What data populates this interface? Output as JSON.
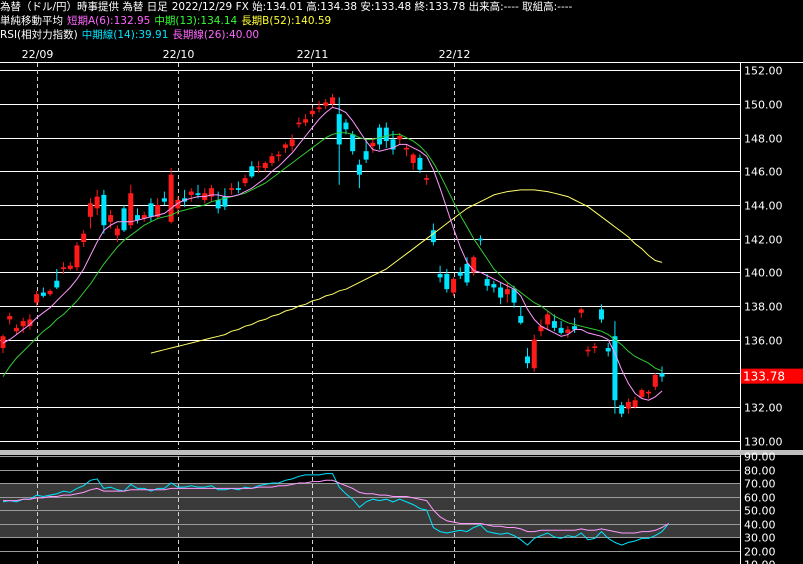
{
  "header": {
    "title": "為替（ドル/円）時事提供 為替 日足",
    "ohlc": "2022/12/29 FX 始:134.01 高:134.38 安:133.48 終:133.78 出来高:---- 取組高:----",
    "ma_label": "単純移動平均",
    "ma_short": "短期A(6):132.95",
    "ma_mid": "中期(13):134.14",
    "ma_long": "長期B(52):140.59",
    "rsi_label": "RSI(相対力指数)",
    "rsi_mid": "中期線(14):39.91",
    "rsi_long": "長期線(26):40.00"
  },
  "colors": {
    "up": "#ff1a1a",
    "down": "#00e5ff",
    "ma_short": "#ff99ff",
    "ma_mid": "#33cc33",
    "ma_long": "#ffff66",
    "rsi_mid": "#00e5ff",
    "rsi_long": "#ff99ff",
    "last_price_bg": "#ff0000",
    "header_ma_short": "#ff66ff",
    "header_ma_mid": "#33ff33",
    "header_ma_long": "#ffff33",
    "header_rsi_mid": "#00e5ff",
    "header_rsi_long": "#ff66ff"
  },
  "last_price": "133.78",
  "chart_data": [
    {
      "type": "candlestick",
      "title": "",
      "ylim": [
        129.5,
        152.5
      ],
      "y_ticks": [
        "152.00",
        "150.00",
        "148.00",
        "146.00",
        "144.00",
        "142.00",
        "140.00",
        "138.00",
        "136.00",
        "134.00",
        "132.00",
        "130.00"
      ],
      "date_labels": [
        "22/09",
        "22/10",
        "22/11",
        "22/12"
      ],
      "date_label_index": [
        5,
        26,
        46,
        67
      ],
      "candles": [
        {
          "o": 135.5,
          "h": 136.3,
          "l": 135.2,
          "c": 136.2
        },
        {
          "o": 137.2,
          "h": 137.6,
          "l": 136.9,
          "c": 137.4
        },
        {
          "o": 136.5,
          "h": 136.9,
          "l": 136.3,
          "c": 136.7
        },
        {
          "o": 136.8,
          "h": 137.3,
          "l": 136.4,
          "c": 137.1
        },
        {
          "o": 136.8,
          "h": 137.5,
          "l": 136.6,
          "c": 137.2
        },
        {
          "o": 138.2,
          "h": 138.9,
          "l": 138.0,
          "c": 138.7
        },
        {
          "o": 138.8,
          "h": 139.1,
          "l": 138.5,
          "c": 138.6
        },
        {
          "o": 138.7,
          "h": 139.0,
          "l": 138.6,
          "c": 138.9
        },
        {
          "o": 139.5,
          "h": 140.2,
          "l": 139.0,
          "c": 139.1
        },
        {
          "o": 140.2,
          "h": 140.6,
          "l": 139.9,
          "c": 140.3
        },
        {
          "o": 140.2,
          "h": 140.6,
          "l": 140.1,
          "c": 140.4
        },
        {
          "o": 140.3,
          "h": 141.8,
          "l": 140.1,
          "c": 141.6
        },
        {
          "o": 141.8,
          "h": 142.5,
          "l": 141.5,
          "c": 142.3
        },
        {
          "o": 143.3,
          "h": 144.4,
          "l": 142.6,
          "c": 144.1
        },
        {
          "o": 143.8,
          "h": 144.9,
          "l": 143.4,
          "c": 144.5
        },
        {
          "o": 144.6,
          "h": 144.9,
          "l": 142.3,
          "c": 142.8
        },
        {
          "o": 143.0,
          "h": 143.7,
          "l": 142.6,
          "c": 143.4
        },
        {
          "o": 142.2,
          "h": 142.8,
          "l": 141.8,
          "c": 142.6
        },
        {
          "o": 143.8,
          "h": 144.0,
          "l": 142.4,
          "c": 142.5
        },
        {
          "o": 142.8,
          "h": 145.2,
          "l": 142.6,
          "c": 144.7
        },
        {
          "o": 143.4,
          "h": 143.8,
          "l": 142.9,
          "c": 143.1
        },
        {
          "o": 143.2,
          "h": 143.6,
          "l": 143.0,
          "c": 143.4
        },
        {
          "o": 144.1,
          "h": 144.4,
          "l": 143.0,
          "c": 143.3
        },
        {
          "o": 143.3,
          "h": 144.4,
          "l": 143.2,
          "c": 144.0
        },
        {
          "o": 144.4,
          "h": 144.8,
          "l": 144.0,
          "c": 144.2
        },
        {
          "o": 143.0,
          "h": 146.2,
          "l": 142.9,
          "c": 145.8
        },
        {
          "o": 143.8,
          "h": 144.5,
          "l": 143.4,
          "c": 144.3
        },
        {
          "o": 144.4,
          "h": 144.9,
          "l": 143.9,
          "c": 144.2
        },
        {
          "o": 144.6,
          "h": 145.0,
          "l": 144.2,
          "c": 144.8
        },
        {
          "o": 144.7,
          "h": 145.2,
          "l": 144.4,
          "c": 144.6
        },
        {
          "o": 144.3,
          "h": 145.0,
          "l": 144.1,
          "c": 144.7
        },
        {
          "o": 144.5,
          "h": 145.2,
          "l": 144.2,
          "c": 145.0
        },
        {
          "o": 144.3,
          "h": 144.8,
          "l": 143.5,
          "c": 143.8
        },
        {
          "o": 144.5,
          "h": 145.0,
          "l": 143.7,
          "c": 143.9
        },
        {
          "o": 144.9,
          "h": 145.3,
          "l": 144.6,
          "c": 145.0
        },
        {
          "o": 145.0,
          "h": 145.4,
          "l": 144.7,
          "c": 144.9
        },
        {
          "o": 145.3,
          "h": 145.8,
          "l": 145.1,
          "c": 145.6
        },
        {
          "o": 146.3,
          "h": 146.6,
          "l": 145.6,
          "c": 145.7
        },
        {
          "o": 146.3,
          "h": 146.6,
          "l": 145.9,
          "c": 146.3
        },
        {
          "o": 146.2,
          "h": 146.6,
          "l": 146.0,
          "c": 146.5
        },
        {
          "o": 146.5,
          "h": 147.1,
          "l": 146.3,
          "c": 146.9
        },
        {
          "o": 146.9,
          "h": 147.2,
          "l": 146.6,
          "c": 147.0
        },
        {
          "o": 147.4,
          "h": 147.7,
          "l": 147.1,
          "c": 147.6
        },
        {
          "o": 147.5,
          "h": 148.2,
          "l": 147.2,
          "c": 147.9
        },
        {
          "o": 148.8,
          "h": 149.2,
          "l": 148.6,
          "c": 148.9
        },
        {
          "o": 148.9,
          "h": 149.4,
          "l": 148.7,
          "c": 149.1
        },
        {
          "o": 149.4,
          "h": 149.8,
          "l": 149.2,
          "c": 149.6
        },
        {
          "o": 149.7,
          "h": 150.2,
          "l": 149.5,
          "c": 149.8
        },
        {
          "o": 149.9,
          "h": 150.3,
          "l": 149.7,
          "c": 150.1
        },
        {
          "o": 150.0,
          "h": 150.6,
          "l": 149.8,
          "c": 150.4
        },
        {
          "o": 149.4,
          "h": 150.4,
          "l": 145.2,
          "c": 147.6
        },
        {
          "o": 148.9,
          "h": 149.1,
          "l": 148.2,
          "c": 148.5
        },
        {
          "o": 148.2,
          "h": 148.4,
          "l": 147.0,
          "c": 147.2
        },
        {
          "o": 146.4,
          "h": 146.7,
          "l": 145.0,
          "c": 145.8
        },
        {
          "o": 147.2,
          "h": 147.9,
          "l": 146.5,
          "c": 146.7
        },
        {
          "o": 147.5,
          "h": 148.0,
          "l": 147.1,
          "c": 147.7
        },
        {
          "o": 148.6,
          "h": 148.8,
          "l": 147.3,
          "c": 147.6
        },
        {
          "o": 148.6,
          "h": 148.9,
          "l": 147.4,
          "c": 147.8
        },
        {
          "o": 147.9,
          "h": 148.4,
          "l": 147.0,
          "c": 147.3
        },
        {
          "o": 147.9,
          "h": 148.3,
          "l": 147.6,
          "c": 148.1
        },
        {
          "o": 147.3,
          "h": 147.6,
          "l": 146.9,
          "c": 147.4
        },
        {
          "o": 146.5,
          "h": 147.1,
          "l": 146.1,
          "c": 147.0
        },
        {
          "o": 146.8,
          "h": 147.0,
          "l": 145.9,
          "c": 146.1
        },
        {
          "o": 145.5,
          "h": 145.8,
          "l": 145.2,
          "c": 145.6
        },
        {
          "o": 142.5,
          "h": 142.9,
          "l": 141.6,
          "c": 141.8
        },
        {
          "o": 139.9,
          "h": 140.4,
          "l": 139.4,
          "c": 139.7
        },
        {
          "o": 139.9,
          "h": 140.2,
          "l": 138.8,
          "c": 139.0
        },
        {
          "o": 138.8,
          "h": 139.7,
          "l": 138.6,
          "c": 139.6
        },
        {
          "o": 140.0,
          "h": 140.3,
          "l": 139.6,
          "c": 139.8
        },
        {
          "o": 140.5,
          "h": 140.9,
          "l": 139.2,
          "c": 139.4
        },
        {
          "o": 140.0,
          "h": 141.0,
          "l": 139.8,
          "c": 140.9
        },
        {
          "o": 142.0,
          "h": 142.2,
          "l": 141.6,
          "c": 141.9
        },
        {
          "o": 139.6,
          "h": 139.9,
          "l": 138.9,
          "c": 139.2
        },
        {
          "o": 139.3,
          "h": 139.5,
          "l": 138.8,
          "c": 139.1
        },
        {
          "o": 139.1,
          "h": 139.4,
          "l": 138.1,
          "c": 138.5
        },
        {
          "o": 138.7,
          "h": 139.4,
          "l": 138.2,
          "c": 139.0
        },
        {
          "o": 139.0,
          "h": 139.2,
          "l": 137.9,
          "c": 138.2
        },
        {
          "o": 137.4,
          "h": 138.0,
          "l": 136.9,
          "c": 137.0
        },
        {
          "o": 135.0,
          "h": 135.5,
          "l": 134.3,
          "c": 134.6
        },
        {
          "o": 134.3,
          "h": 136.3,
          "l": 134.1,
          "c": 136.0
        },
        {
          "o": 136.5,
          "h": 137.2,
          "l": 136.2,
          "c": 136.8
        },
        {
          "o": 136.9,
          "h": 137.7,
          "l": 136.6,
          "c": 137.5
        },
        {
          "o": 137.1,
          "h": 137.5,
          "l": 136.5,
          "c": 136.7
        },
        {
          "o": 136.7,
          "h": 137.1,
          "l": 136.3,
          "c": 136.4
        },
        {
          "o": 136.4,
          "h": 136.8,
          "l": 136.1,
          "c": 136.6
        },
        {
          "o": 136.8,
          "h": 137.3,
          "l": 136.4,
          "c": 136.6
        },
        {
          "o": 137.6,
          "h": 137.9,
          "l": 137.3,
          "c": 137.8
        },
        {
          "o": 135.3,
          "h": 135.6,
          "l": 135.0,
          "c": 135.4
        },
        {
          "o": 135.5,
          "h": 135.8,
          "l": 135.2,
          "c": 135.6
        },
        {
          "o": 137.8,
          "h": 138.1,
          "l": 137.0,
          "c": 137.2
        },
        {
          "o": 135.5,
          "h": 135.8,
          "l": 135.0,
          "c": 135.3
        },
        {
          "o": 136.2,
          "h": 137.1,
          "l": 131.6,
          "c": 132.4
        },
        {
          "o": 132.1,
          "h": 132.3,
          "l": 131.4,
          "c": 131.6
        },
        {
          "o": 131.9,
          "h": 132.5,
          "l": 131.6,
          "c": 132.3
        },
        {
          "o": 132.0,
          "h": 132.6,
          "l": 131.9,
          "c": 132.4
        },
        {
          "o": 132.6,
          "h": 133.1,
          "l": 132.5,
          "c": 133.0
        },
        {
          "o": 132.8,
          "h": 133.0,
          "l": 132.5,
          "c": 132.9
        },
        {
          "o": 133.2,
          "h": 134.0,
          "l": 133.0,
          "c": 133.9
        },
        {
          "o": 134.0,
          "h": 134.4,
          "l": 133.5,
          "c": 133.8
        }
      ],
      "ma_short": [
        135.8,
        136.0,
        136.3,
        136.6,
        136.9,
        137.3,
        137.6,
        137.9,
        138.3,
        138.7,
        139.1,
        139.6,
        140.2,
        141.0,
        141.8,
        142.5,
        142.8,
        143.0,
        143.0,
        143.0,
        143.1,
        143.2,
        143.3,
        143.4,
        143.5,
        143.8,
        144.1,
        144.3,
        144.4,
        144.5,
        144.5,
        144.6,
        144.6,
        144.5,
        144.5,
        144.6,
        144.8,
        145.0,
        145.3,
        145.6,
        146.0,
        146.3,
        146.7,
        147.1,
        147.6,
        148.1,
        148.6,
        149.1,
        149.5,
        149.8,
        149.7,
        149.5,
        149.0,
        148.4,
        147.8,
        147.3,
        147.2,
        147.3,
        147.4,
        147.6,
        147.6,
        147.4,
        147.2,
        146.9,
        146.1,
        145.0,
        143.8,
        142.6,
        141.5,
        140.6,
        140.1,
        140.0,
        139.8,
        139.6,
        139.4,
        139.2,
        139.0,
        138.6,
        137.8,
        137.2,
        136.8,
        136.6,
        136.4,
        136.2,
        136.3,
        136.6,
        136.6,
        136.4,
        136.3,
        136.2,
        136.0,
        135.2,
        134.2,
        133.4,
        132.8,
        132.5,
        132.4,
        132.6,
        132.95
      ],
      "ma_mid": [
        133.8,
        134.4,
        134.9,
        135.3,
        135.7,
        136.1,
        136.5,
        136.8,
        137.2,
        137.5,
        137.9,
        138.3,
        138.8,
        139.3,
        139.9,
        140.5,
        141.0,
        141.5,
        141.9,
        142.2,
        142.5,
        142.8,
        143.0,
        143.2,
        143.3,
        143.4,
        143.6,
        143.7,
        143.8,
        143.9,
        144.0,
        144.2,
        144.3,
        144.4,
        144.5,
        144.6,
        144.7,
        144.9,
        145.1,
        145.3,
        145.6,
        145.9,
        146.2,
        146.5,
        146.8,
        147.1,
        147.4,
        147.7,
        148.0,
        148.2,
        148.3,
        148.3,
        148.2,
        148.0,
        147.9,
        147.9,
        148.0,
        148.1,
        148.2,
        148.2,
        148.0,
        147.8,
        147.5,
        147.1,
        146.5,
        145.8,
        145.0,
        144.2,
        143.4,
        142.7,
        142.0,
        141.4,
        140.8,
        140.2,
        139.8,
        139.4,
        139.1,
        138.8,
        138.5,
        138.2,
        138.0,
        137.7,
        137.4,
        137.2,
        137.0,
        136.9,
        136.8,
        136.7,
        136.6,
        136.5,
        136.3,
        136.0,
        135.7,
        135.3,
        135.0,
        134.8,
        134.6,
        134.3,
        134.14
      ],
      "ma_long": [
        135.2,
        135.3,
        135.4,
        135.5,
        135.6,
        135.7,
        135.8,
        135.9,
        136.0,
        136.1,
        136.2,
        136.3,
        136.5,
        136.6,
        136.8,
        136.9,
        137.1,
        137.2,
        137.4,
        137.5,
        137.7,
        137.8,
        138.0,
        138.1,
        138.3,
        138.4,
        138.6,
        138.7,
        138.9,
        139.0,
        139.2,
        139.4,
        139.6,
        139.8,
        140.0,
        140.2,
        140.5,
        140.8,
        141.1,
        141.4,
        141.7,
        142.0,
        142.3,
        142.6,
        142.9,
        143.2,
        143.5,
        143.8,
        144.0,
        144.2,
        144.4,
        144.6,
        144.7,
        144.8,
        144.85,
        144.9,
        144.9,
        144.9,
        144.85,
        144.8,
        144.7,
        144.6,
        144.5,
        144.3,
        144.1,
        143.9,
        143.6,
        143.3,
        143.0,
        142.7,
        142.4,
        142.1,
        141.7,
        141.4,
        141.0,
        140.7,
        140.59
      ],
      "ma_long_start": 22
    },
    {
      "type": "line",
      "title": "",
      "ylim": [
        10,
        90
      ],
      "y_ticks": [
        "90.00",
        "80.00",
        "70.00",
        "60.00",
        "50.00",
        "40.00",
        "30.00",
        "20.00",
        "10.00"
      ],
      "series": [
        {
          "key": "rsi_mid",
          "values": [
            56,
            57,
            56,
            58,
            58,
            61,
            60,
            61,
            62,
            64,
            63,
            66,
            68,
            72,
            73,
            66,
            67,
            65,
            64,
            69,
            66,
            66,
            64,
            66,
            66,
            70,
            67,
            67,
            68,
            67,
            67,
            68,
            65,
            65,
            66,
            65,
            67,
            66,
            68,
            69,
            70,
            70,
            72,
            73,
            75,
            76,
            76,
            76,
            77,
            77,
            67,
            62,
            58,
            52,
            56,
            58,
            57,
            58,
            56,
            58,
            56,
            54,
            51,
            50,
            37,
            34,
            33,
            34,
            35,
            34,
            37,
            39,
            34,
            33,
            32,
            33,
            31,
            28,
            24,
            29,
            31,
            33,
            30,
            29,
            31,
            30,
            33,
            28,
            29,
            34,
            29,
            26,
            24,
            26,
            27,
            29,
            29,
            31,
            34,
            39.91
          ]
        },
        {
          "key": "rsi_long",
          "values": [
            57,
            57,
            57,
            58,
            58,
            59,
            59,
            60,
            60,
            61,
            61,
            62,
            63,
            65,
            66,
            64,
            64,
            64,
            64,
            65,
            65,
            65,
            65,
            65,
            65,
            66,
            66,
            66,
            66,
            66,
            66,
            66,
            66,
            66,
            66,
            66,
            66,
            66,
            67,
            67,
            67,
            68,
            68,
            69,
            70,
            70,
            71,
            71,
            72,
            72,
            70,
            68,
            66,
            63,
            62,
            62,
            61,
            61,
            60,
            60,
            60,
            59,
            58,
            57,
            50,
            45,
            42,
            41,
            40,
            40,
            40,
            40,
            39,
            38,
            38,
            37,
            37,
            36,
            34,
            34,
            35,
            35,
            35,
            35,
            35,
            35,
            36,
            35,
            35,
            36,
            35,
            34,
            33,
            33,
            33,
            34,
            34,
            35,
            37,
            40.0
          ]
        }
      ]
    }
  ]
}
